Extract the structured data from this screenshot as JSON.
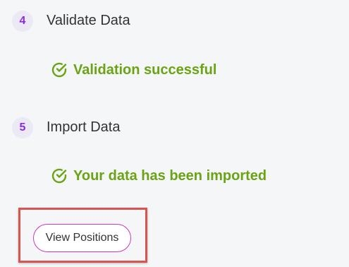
{
  "steps": [
    {
      "number": "4",
      "title": "Validate Data",
      "status": "Validation successful",
      "status_icon": "check-circle-icon"
    },
    {
      "number": "5",
      "title": "Import Data",
      "status": "Your data has been imported",
      "status_icon": "check-circle-icon"
    }
  ],
  "actions": {
    "view_positions_label": "View Positions"
  },
  "colors": {
    "background": "#f5f6f8",
    "badge_bg": "#ece9f7",
    "badge_text": "#8a2be2",
    "success": "#6aa314",
    "button_border": "#c63ab8",
    "highlight": "#d9534f"
  }
}
